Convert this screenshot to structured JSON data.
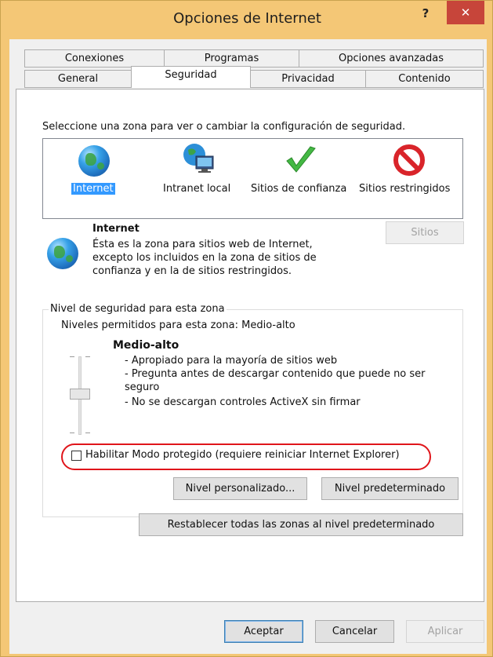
{
  "window": {
    "title": "Opciones de Internet",
    "help_label": "?",
    "close_label": "✕"
  },
  "tabs": {
    "row_top": [
      "Conexiones",
      "Programas",
      "Opciones avanzadas"
    ],
    "row_bottom": [
      "General",
      "Seguridad",
      "Privacidad",
      "Contenido"
    ],
    "active": "Seguridad"
  },
  "security": {
    "instruction": "Seleccione una zona para ver o cambiar la configuración de seguridad.",
    "zones": [
      {
        "label": "Internet",
        "icon": "globe-icon",
        "selected": true
      },
      {
        "label": "Intranet local",
        "icon": "intranet-icon",
        "selected": false
      },
      {
        "label": "Sitios de confianza",
        "icon": "checkmark-icon",
        "selected": false
      },
      {
        "label": "Sitios restringidos",
        "icon": "restricted-icon",
        "selected": false
      }
    ],
    "selected_zone": {
      "name": "Internet",
      "description_lines": [
        "Ésta es la zona para sitios web de Internet,",
        "excepto los incluidos en la zona de sitios de",
        "confianza y en la de sitios restringidos."
      ],
      "sites_button": "Sitios"
    },
    "level_group": {
      "legend": "Nivel de seguridad para esta zona",
      "allowed_levels": "Niveles permitidos para esta zona: Medio-alto",
      "level_name": "Medio-alto",
      "level_points": [
        "- Apropiado para la mayoría de sitios web",
        "- Pregunta antes de descargar contenido que puede no ser",
        "seguro",
        "- No se descargan controles ActiveX sin firmar"
      ],
      "protected_mode_label": "Habilitar Modo protegido (requiere reiniciar Internet Explorer)",
      "protected_mode_checked": false,
      "custom_level_button": "Nivel personalizado...",
      "default_level_button": "Nivel predeterminado"
    },
    "reset_all_button": "Restablecer todas las zonas al nivel predeterminado"
  },
  "footer": {
    "ok": "Aceptar",
    "cancel": "Cancelar",
    "apply": "Aplicar"
  },
  "colors": {
    "title_bar": "#f4c776",
    "close_button": "#c7453a",
    "selection": "#3399ff",
    "annotation_ring": "#e0151b"
  }
}
